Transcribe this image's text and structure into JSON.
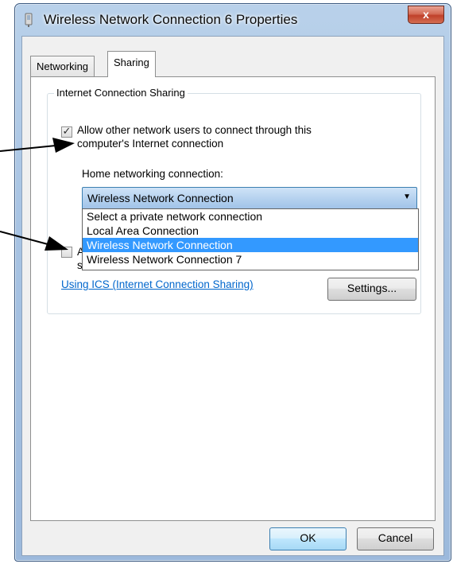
{
  "window": {
    "title": "Wireless Network Connection 6 Properties",
    "close_label": "x"
  },
  "tabs": [
    {
      "label": "Networking",
      "active": false
    },
    {
      "label": "Sharing",
      "active": true
    }
  ],
  "sharing": {
    "group_title": "Internet Connection Sharing",
    "allow_checkbox": {
      "checked": true,
      "label_line1": "Allow other network users to connect through this",
      "label_line2": "computer's Internet connection"
    },
    "home_label": "Home networking connection:",
    "combo_value": "Wireless Network Connection",
    "dropdown_options": [
      {
        "label": "Select a private network connection",
        "selected": false
      },
      {
        "label": "Local Area Connection",
        "selected": false
      },
      {
        "label": "Wireless Network Connection",
        "selected": true
      },
      {
        "label": "Wireless Network Connection 7",
        "selected": false
      }
    ],
    "control_checkbox": {
      "checked": false,
      "label_line1": "A",
      "label_line2": "s"
    },
    "ics_link": "Using ICS (Internet Connection Sharing)",
    "settings_label": "Settings..."
  },
  "footer": {
    "ok_label": "OK",
    "cancel_label": "Cancel"
  },
  "colors": {
    "selection": "#3399ff",
    "link": "#0066cc",
    "close_button": "#c0402a"
  }
}
